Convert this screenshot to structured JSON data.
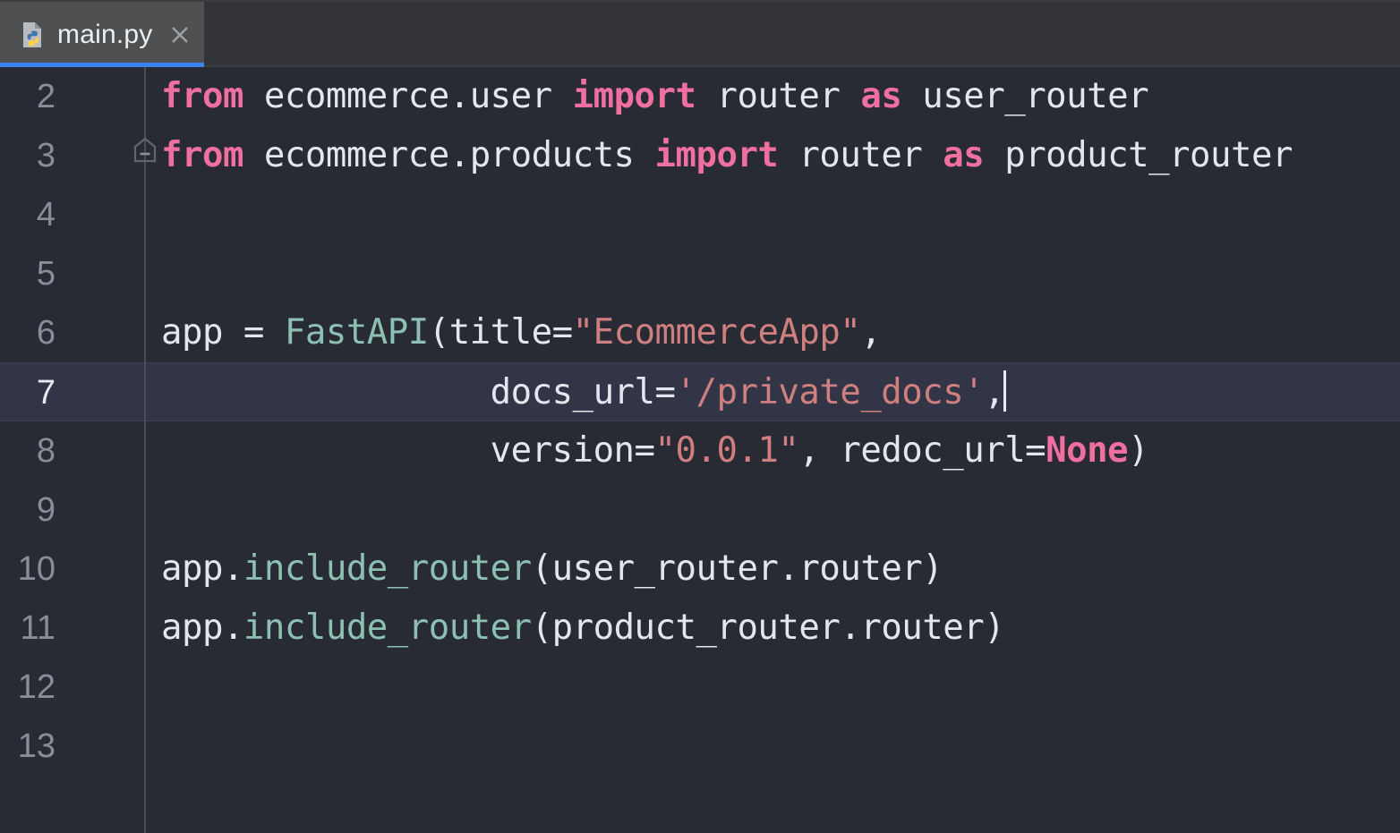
{
  "window": {
    "title": "main.py",
    "theme_background": "#282a34",
    "tabbar_background": "#333437",
    "active_tab_underline": "#3c84f0",
    "current_line_background": "#323545"
  },
  "tabbar": {
    "tabs": [
      {
        "label": "main.py",
        "icon": "python-file-icon",
        "active": true,
        "close_icon": "close-icon"
      }
    ]
  },
  "editor": {
    "language": "Python",
    "caret_line": 7,
    "caret_column": 37,
    "first_visible_line": 2,
    "last_visible_line": 13,
    "fold_marker_line": 3,
    "fold_marker_state": "expanded",
    "colors": {
      "keyword": "#ef6f9e",
      "function": "#8cc0b0",
      "string": "#cf7f7f",
      "default_text": "#e3e6ee",
      "line_number": "#8a8d99",
      "line_number_active": "#e6e9f0",
      "gutter_rule": "#4a4d59"
    },
    "lines": [
      {
        "number": "2",
        "current": false,
        "fold": false,
        "tokens": [
          {
            "t": "from",
            "c": "kw"
          },
          {
            "t": " ecommerce.user ",
            "c": "def"
          },
          {
            "t": "import",
            "c": "kw"
          },
          {
            "t": " router ",
            "c": "def"
          },
          {
            "t": "as",
            "c": "kw"
          },
          {
            "t": " user_router",
            "c": "def"
          }
        ]
      },
      {
        "number": "3",
        "current": false,
        "fold": true,
        "tokens": [
          {
            "t": "from",
            "c": "kw"
          },
          {
            "t": " ecommerce.products ",
            "c": "def"
          },
          {
            "t": "import",
            "c": "kw"
          },
          {
            "t": " router ",
            "c": "def"
          },
          {
            "t": "as",
            "c": "kw"
          },
          {
            "t": " product_router",
            "c": "def"
          }
        ]
      },
      {
        "number": "4",
        "current": false,
        "fold": false,
        "tokens": []
      },
      {
        "number": "5",
        "current": false,
        "fold": false,
        "tokens": []
      },
      {
        "number": "6",
        "current": false,
        "fold": false,
        "tokens": [
          {
            "t": "app = ",
            "c": "def"
          },
          {
            "t": "FastAPI",
            "c": "fn"
          },
          {
            "t": "(title=",
            "c": "def"
          },
          {
            "t": "\"EcommerceApp\"",
            "c": "str"
          },
          {
            "t": ",",
            "c": "def"
          }
        ]
      },
      {
        "number": "7",
        "current": true,
        "fold": false,
        "caret_after": true,
        "tokens": [
          {
            "t": "                docs_url=",
            "c": "def"
          },
          {
            "t": "'/private_docs'",
            "c": "str"
          },
          {
            "t": ",",
            "c": "def"
          }
        ]
      },
      {
        "number": "8",
        "current": false,
        "fold": false,
        "tokens": [
          {
            "t": "                version=",
            "c": "def"
          },
          {
            "t": "\"0.0.1\"",
            "c": "str"
          },
          {
            "t": ", redoc_url=",
            "c": "def"
          },
          {
            "t": "None",
            "c": "none"
          },
          {
            "t": ")",
            "c": "def"
          }
        ]
      },
      {
        "number": "9",
        "current": false,
        "fold": false,
        "tokens": []
      },
      {
        "number": "10",
        "current": false,
        "fold": false,
        "tokens": [
          {
            "t": "app.",
            "c": "def"
          },
          {
            "t": "include_router",
            "c": "fn"
          },
          {
            "t": "(user_router.router)",
            "c": "def"
          }
        ]
      },
      {
        "number": "11",
        "current": false,
        "fold": false,
        "tokens": [
          {
            "t": "app.",
            "c": "def"
          },
          {
            "t": "include_router",
            "c": "fn"
          },
          {
            "t": "(product_router.router)",
            "c": "def"
          }
        ]
      },
      {
        "number": "12",
        "current": false,
        "fold": false,
        "tokens": []
      },
      {
        "number": "13",
        "current": false,
        "fold": false,
        "tokens": []
      }
    ]
  }
}
